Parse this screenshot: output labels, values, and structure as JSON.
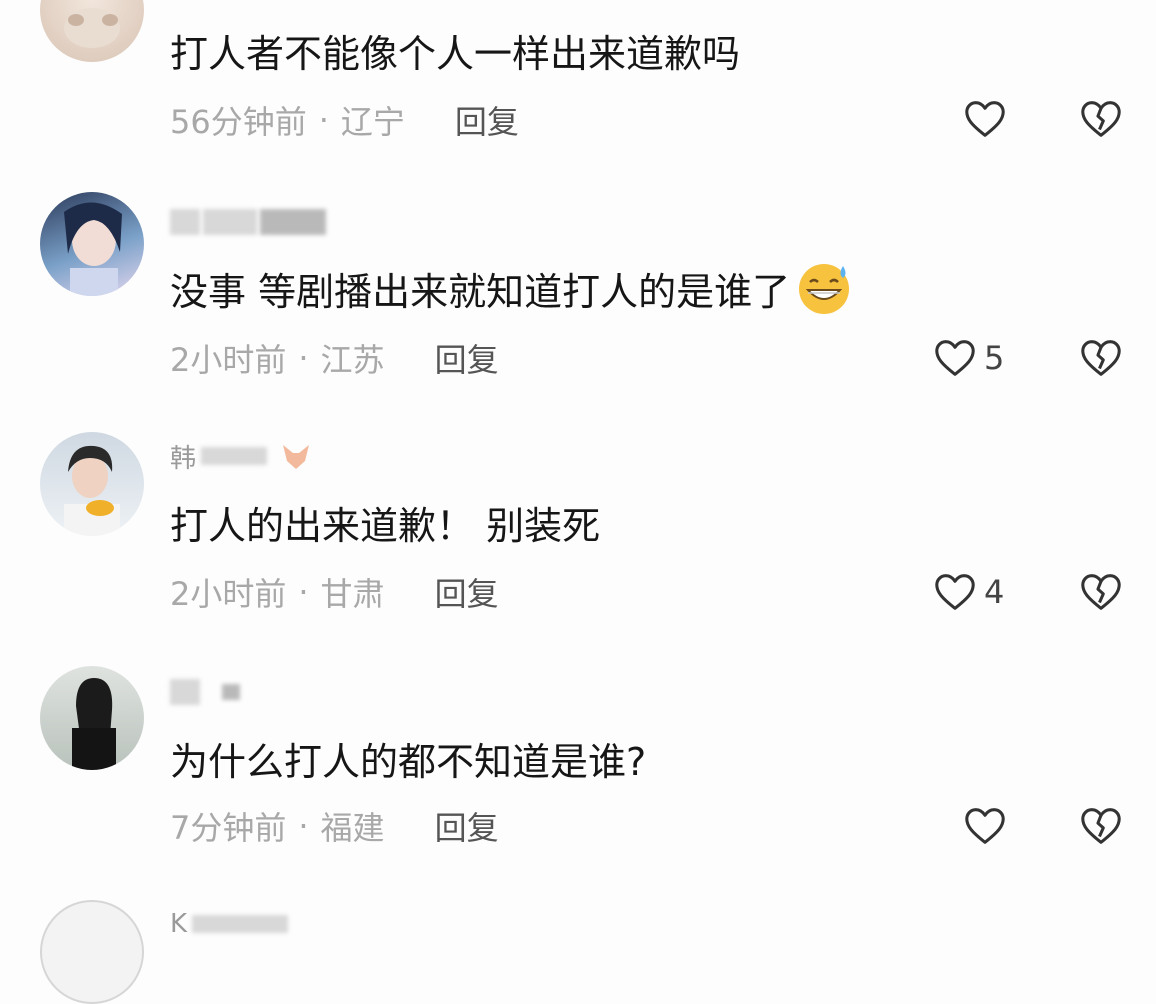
{
  "comments": [
    {
      "username": "",
      "text": "打人者不能像个人一样出来道歉吗",
      "time": "56分钟前",
      "location": "辽宁",
      "reply_label": "回复",
      "likes": "",
      "has_emoji": false
    },
    {
      "username": "",
      "text": "没事 等剧播出来就知道打人的是谁了",
      "time": "2小时前",
      "location": "江苏",
      "reply_label": "回复",
      "likes": "5",
      "has_emoji": true
    },
    {
      "username": "韩",
      "text": "打人的出来道歉！ 别装死",
      "time": "2小时前",
      "location": "甘肃",
      "reply_label": "回复",
      "likes": "4",
      "has_emoji": false
    },
    {
      "username": "",
      "text": "为什么打人的都不知道是谁?",
      "time": "7分钟前",
      "location": "福建",
      "reply_label": "回复",
      "likes": "",
      "has_emoji": false
    },
    {
      "username": "K",
      "text": "",
      "time": "",
      "location": "",
      "reply_label": "",
      "likes": "",
      "has_emoji": false
    }
  ],
  "separator": "·",
  "icons": {
    "like": "heart-outline-icon",
    "dislike": "broken-heart-icon",
    "emoji": "sweat-grin-emoji-icon"
  }
}
